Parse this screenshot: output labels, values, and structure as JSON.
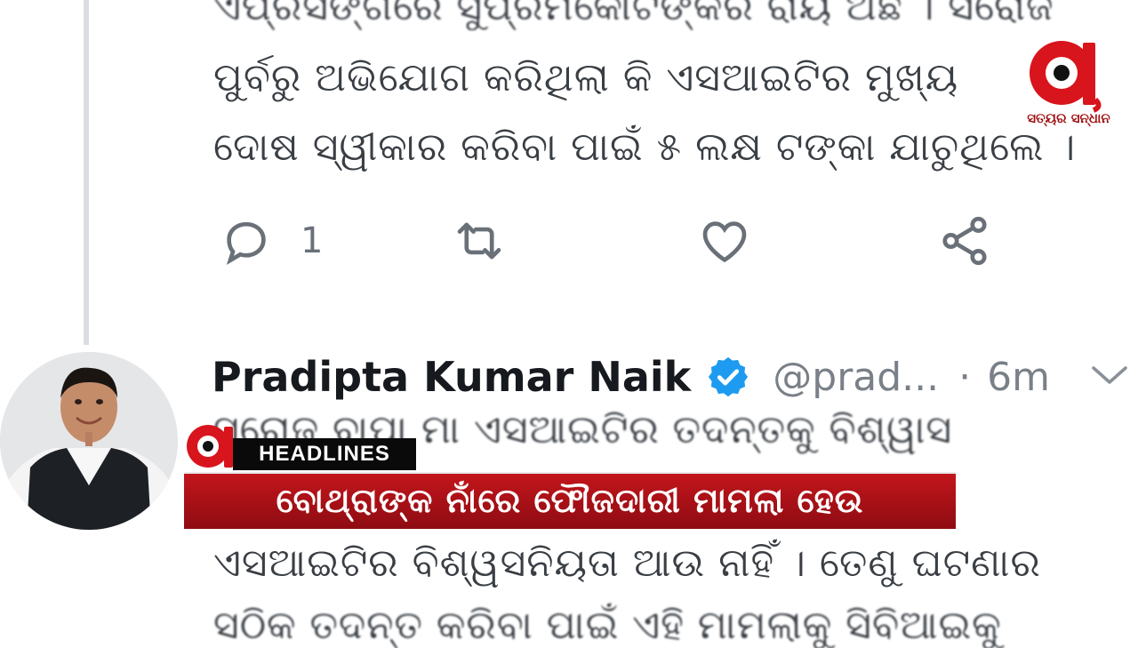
{
  "tweet_prev": {
    "lines": [
      "ଏପ୍ରସଙ୍ଗରେ ସୁପ୍ରିମକୋର୍ଟଙ୍କର ରାୟ ଅଛି । ସରୋଜ",
      "ପୁର୍ବରୁ ଅଭିଯୋଗ କରିଥିଲା କି ଏସଆଇଟିର ମୁଖ୍ୟ",
      "ଦୋଷ ସ୍ୱୀକାର କରିବା ପାଇଁ ୫ ଲକ୍ଷ ଟଙ୍କା ଯାଚୁଥିଲେ ।"
    ],
    "reply_count": "1"
  },
  "tweet": {
    "author_name": "Pradipta Kumar Naik",
    "handle": "@prad...",
    "separator": "·",
    "time": "6m",
    "lines": [
      "ସରୋଜ ବାପା ମା ଏସଆଇଟିର ତଦନ୍ତକୁ ବିଶ୍ୱାସ",
      "ଏସଆଇଟିର ବିଶ୍ୱସନିୟତା ଆଉ ନାହିଁ । ତେଣୁ ଘଟଣାର",
      "ସଠିକ ତଦନ୍ତ କରିବା ପାଇଁ ଏହି ମାମଲାକୁ ସିବିଆଇକୁ"
    ]
  },
  "channel": {
    "logo_letter": "a",
    "tagline": "ସତ୍ୟର ସନ୍ଧାନ",
    "brand_color": "#d8141c"
  },
  "ticker": {
    "tag": "HEADLINES",
    "headline": "ବୋଥ୍ରାଙ୍କ ନାଁରେ ଫୌଜଦାରୀ ମାମଲା ହେଉ"
  },
  "icons": {
    "reply": "reply-icon",
    "retweet": "retweet-icon",
    "like": "like-icon",
    "share": "share-icon",
    "verified": "verified-badge-icon",
    "more": "chevron-down-icon"
  }
}
